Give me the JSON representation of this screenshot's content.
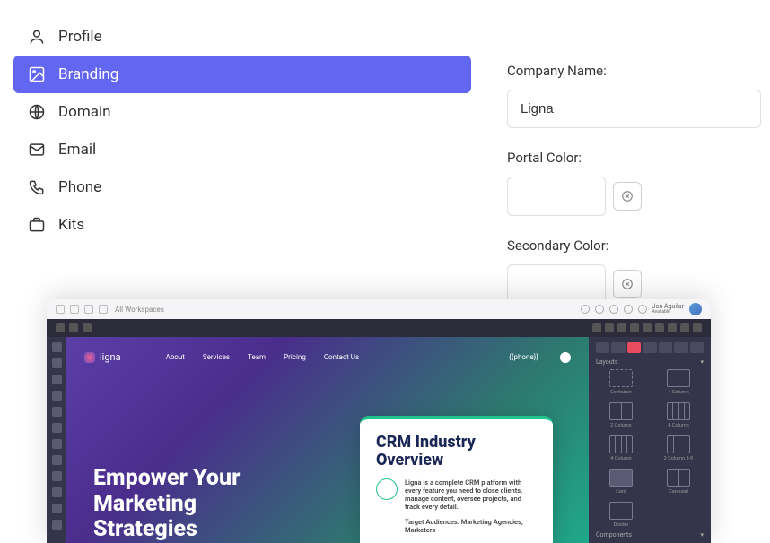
{
  "sidebar": {
    "items": [
      {
        "label": "Profile"
      },
      {
        "label": "Branding"
      },
      {
        "label": "Domain"
      },
      {
        "label": "Email"
      },
      {
        "label": "Phone"
      },
      {
        "label": "Kits"
      }
    ]
  },
  "form": {
    "company_name": {
      "label": "Company Name:",
      "value": "Ligna"
    },
    "portal_color": {
      "label": "Portal Color:",
      "value": ""
    },
    "secondary_color": {
      "label": "Secondary Color:",
      "value": ""
    }
  },
  "editor": {
    "topbar": {
      "workspace": "All Workspaces",
      "user": "Jon Aguilar",
      "status": "Available"
    },
    "logo": "ligna",
    "nav": [
      "About",
      "Services",
      "Team",
      "Pricing",
      "Contact Us"
    ],
    "phone": "{{phone}}",
    "hero": {
      "line1": "Empower Your",
      "line2": "Marketing",
      "line3": "Strategies"
    },
    "card": {
      "title": "CRM Industry Overview",
      "body": "Ligna is a complete CRM platform with every feature you need to close clients, manage content, oversee projects, and track every detail.",
      "target": "Target Audiences: Marketing Agencies, Marketers"
    },
    "rpanel": {
      "layouts_label": "Layouts",
      "components_label": "Components",
      "items": [
        "Container",
        "1 Column",
        "2 Column",
        "4 Column",
        "4 Column",
        "2 Column 3-9",
        "Card",
        "Carousel",
        "Divider"
      ]
    }
  }
}
